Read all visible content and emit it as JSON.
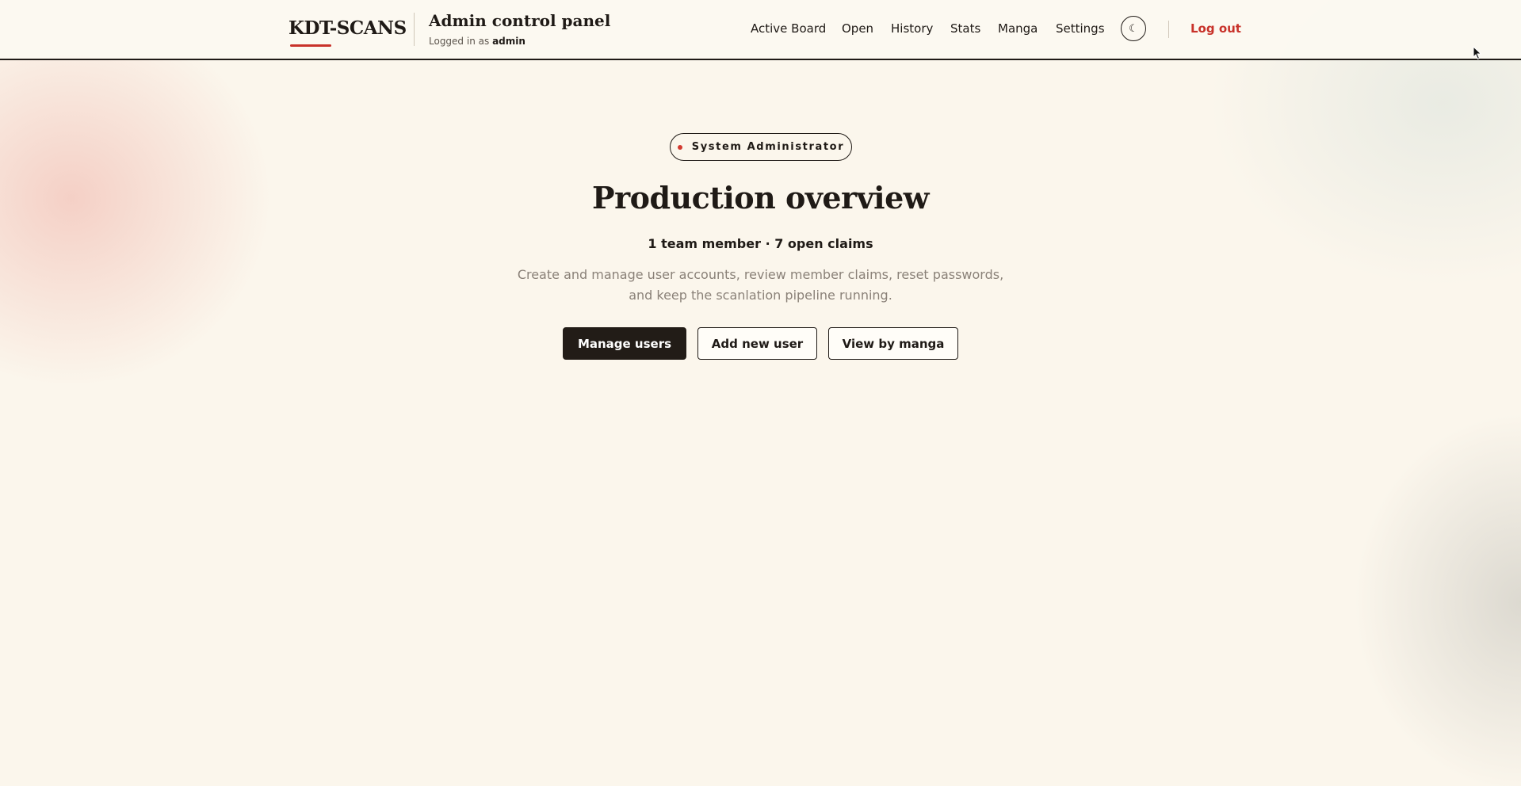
{
  "header": {
    "brand": "KDT-SCANS",
    "panel_title": "Admin control panel",
    "logged_in_prefix": "Logged in as",
    "username": "admin",
    "nav": {
      "active_board": "Active Board",
      "open": "Open",
      "history": "History",
      "stats": "Stats",
      "manga": "Manga",
      "settings": "Settings"
    },
    "theme_toggle_glyph": "☾",
    "logout": "Log out"
  },
  "hero": {
    "role_badge": "System Administrator",
    "title": "Production overview",
    "stats": "1 team member · 7 open claims",
    "description": "Create and manage user accounts, review member claims, reset passwords, and keep the scanlation pipeline running.",
    "buttons": {
      "manage_users": "Manage users",
      "add_new_user": "Add new user",
      "view_by_manga": "View by manga"
    }
  },
  "colors": {
    "accent_red": "#c8322a",
    "ink": "#1f1a16",
    "background": "#fbf6ec"
  },
  "icons": {
    "theme_toggle": "moon-icon",
    "badge_dot": "status-dot-icon",
    "cursor": "mouse-pointer-icon"
  }
}
